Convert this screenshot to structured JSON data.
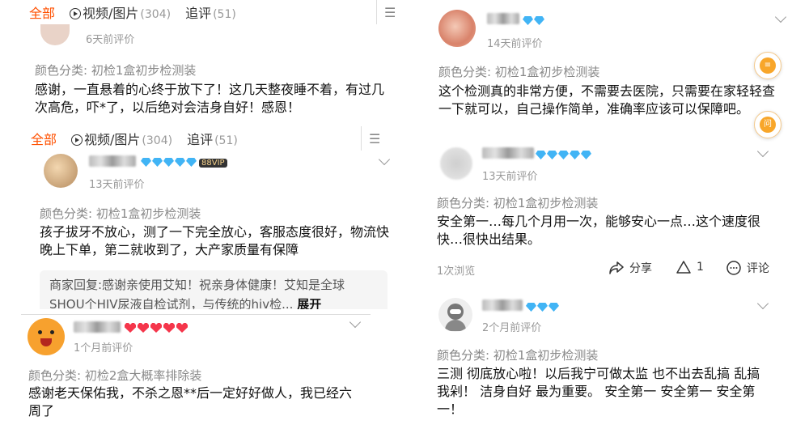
{
  "colors": {
    "accent": "#ff5000",
    "diamond": "#41b4f5",
    "heart": "#f5364b",
    "sub_text": "#999999"
  },
  "tabs_top": {
    "all": "全部",
    "media": "视频/图片",
    "media_count": "(304)",
    "followup": "追评",
    "followup_count": "(51)"
  },
  "tabs_mid": {
    "all": "全部",
    "media": "视频/图片",
    "media_count": "(304)",
    "followup": "追评",
    "followup_count": "(51)"
  },
  "review1": {
    "time": "6天前评价",
    "category": "颜色分类: 初检1盒初步检测装",
    "text": "感谢，一直悬着的心终于放下了！这几天整夜睡不着，有过几次高危，吓*了，以后绝对会洁身自好！感恩！"
  },
  "review2": {
    "vip": "88VIP",
    "time": "13天前评价",
    "category": "颜色分类: 初检1盒初步检测装",
    "text": "孩子拔牙不放心，测了一下完全放心，客服态度很好，物流快晚上下单，第二就收到了，大产家质量有保障",
    "reply": "商家回复:感谢亲使用艾知！祝亲身体健康！艾知是全球SHOU个HIV尿液自检试剂，与传统的hiv检...",
    "reply_more": "展开"
  },
  "review3": {
    "time": "1个月前评价",
    "category": "颜色分类: 初检2盒大概率排除装",
    "text": "感谢老天保佑我，不杀之恩**后一定好好做人，我已经六周了"
  },
  "review4": {
    "time": "14天前评价",
    "category": "颜色分类: 初检1盒初步检测装",
    "text": "这个检测真的非常方便，不需要去医院，只需要在家轻轻查一下就可以，自己操作简单，准确率应该可以保障吧。"
  },
  "side_buttons": {
    "top_icon": "notes-icon",
    "bottom": "问"
  },
  "review5": {
    "time": "13天前评价",
    "category": "颜色分类: 初检1盒初步检测装",
    "text": "安全第一…每几个月用一次，能够安心一点…这个速度很快…很快出结果。",
    "views": "1次浏览",
    "share": "分享",
    "likes": "1",
    "comment": "评论"
  },
  "review6": {
    "time": "2个月前评价",
    "category": "颜色分类: 初检1盒初步检测装",
    "text": "三测 彻底放心啦！以后我宁可做太监 也不出去乱搞 乱搞我剁！ 洁身自好 最为重要。 安全第一 安全第一 安全第一！"
  }
}
